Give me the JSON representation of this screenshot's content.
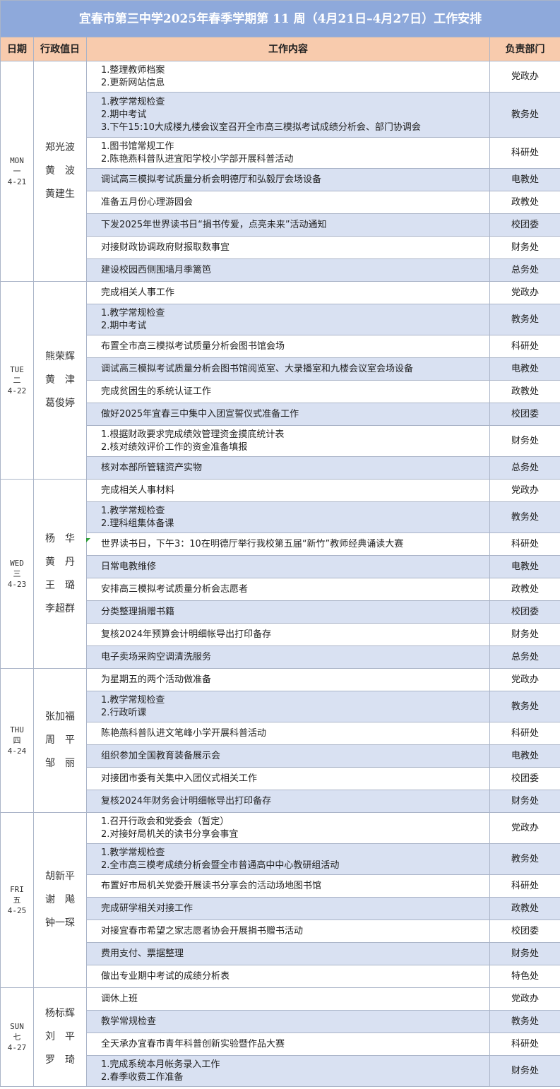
{
  "title": "宜春市第三中学2025年春季学期第 11 周（4月21日–4月27日）工作安排",
  "headers": {
    "date": "日期",
    "duty": "行政值日",
    "content": "工作内容",
    "dept": "负责部门"
  },
  "colors": {
    "title_bg": "#8ea9db",
    "header_bg": "#f8cbad",
    "alt_row": "#d9e1f2"
  },
  "days": [
    {
      "code": "MON",
      "cn": "一",
      "date": "4-21",
      "duty": [
        "郑光波",
        "黄　波",
        "黄建生"
      ],
      "items": [
        {
          "lines": [
            "1.整理教师档案",
            "2.更新网站信息"
          ],
          "dept": "党政办"
        },
        {
          "lines": [
            "1.教学常规检查",
            "2.期中考试",
            "3.下午15:10大成楼九楼会议室召开全市高三模拟考试成绩分析会、部门协调会"
          ],
          "dept": "教务处"
        },
        {
          "lines": [
            "1.图书馆常规工作",
            "2.陈艳燕科普队进宜阳学校小学部开展科普活动"
          ],
          "dept": "科研处"
        },
        {
          "lines": [
            "调试高三模拟考试质量分析会明德厅和弘毅厅会场设备"
          ],
          "dept": "电教处"
        },
        {
          "lines": [
            "准备五月份心理游园会"
          ],
          "dept": "政教处"
        },
        {
          "lines": [
            "下发2025年世界读书日“捐书传爱，点亮未来”活动通知"
          ],
          "dept": "校团委"
        },
        {
          "lines": [
            "对接财政协调政府财报取数事宜"
          ],
          "dept": "财务处"
        },
        {
          "lines": [
            "建设校园西侧围墙月季篱笆"
          ],
          "dept": "总务处"
        }
      ]
    },
    {
      "code": "TUE",
      "cn": "二",
      "date": "4-22",
      "duty": [
        "熊荣辉",
        "黄　津",
        "葛俊婷"
      ],
      "items": [
        {
          "lines": [
            "完成相关人事工作"
          ],
          "dept": "党政办"
        },
        {
          "lines": [
            "1.教学常规检查",
            "2.期中考试"
          ],
          "dept": "教务处"
        },
        {
          "lines": [
            "布置全市高三模拟考试质量分析会图书馆会场"
          ],
          "dept": "科研处"
        },
        {
          "lines": [
            "调试高三模拟考试质量分析会图书馆阅览室、大录播室和九楼会议室会场设备"
          ],
          "dept": "电教处"
        },
        {
          "lines": [
            "完成贫困生的系统认证工作"
          ],
          "dept": "政教处"
        },
        {
          "lines": [
            "做好2025年宜春三中集中入团宣誓仪式准备工作"
          ],
          "dept": "校团委"
        },
        {
          "lines": [
            "1.根据财政要求完成绩效管理资金摸底统计表",
            "2.核对绩效评价工作的资金准备填报"
          ],
          "dept": "财务处"
        },
        {
          "lines": [
            "核对本部所管辖资产实物"
          ],
          "dept": "总务处"
        }
      ]
    },
    {
      "code": "WED",
      "cn": "三",
      "date": "4-23",
      "duty": [
        "杨　华",
        "黄　丹",
        "王　璐",
        "李超群"
      ],
      "items": [
        {
          "lines": [
            "完成相关人事材料"
          ],
          "dept": "党政办"
        },
        {
          "lines": [
            "1.教学常规检查",
            "2.理科组集体备课"
          ],
          "dept": "教务处"
        },
        {
          "lines": [
            "世界读书日，下午3：10在明德厅举行我校第五届“新竹”教师经典诵读大赛"
          ],
          "dept": "科研处"
        },
        {
          "lines": [
            "日常电教维修"
          ],
          "dept": "电教处"
        },
        {
          "lines": [
            "安排高三模拟考试质量分析会志愿者"
          ],
          "dept": "政教处"
        },
        {
          "lines": [
            "分类整理捐赠书籍"
          ],
          "dept": "校团委"
        },
        {
          "lines": [
            "复核2024年预算会计明细帐导出打印备存"
          ],
          "dept": "财务处"
        },
        {
          "lines": [
            "电子卖场采购空调清洗服务"
          ],
          "dept": "总务处"
        }
      ]
    },
    {
      "code": "THU",
      "cn": "四",
      "date": "4-24",
      "duty": [
        "张加福",
        "周　平",
        "邹　丽"
      ],
      "items": [
        {
          "lines": [
            "为星期五的两个活动做准备"
          ],
          "dept": "党政办"
        },
        {
          "lines": [
            "1.教学常规检查",
            "2.行政听课"
          ],
          "dept": "教务处"
        },
        {
          "lines": [
            "陈艳燕科普队进文笔峰小学开展科普活动"
          ],
          "dept": "科研处"
        },
        {
          "lines": [
            "组织参加全国教育装备展示会"
          ],
          "dept": "电教处"
        },
        {
          "lines": [
            "对接团市委有关集中入团仪式相关工作"
          ],
          "dept": "校团委"
        },
        {
          "lines": [
            "复核2024年财务会计明细帐导出打印备存"
          ],
          "dept": "财务处"
        }
      ]
    },
    {
      "code": "FRI",
      "cn": "五",
      "date": "4-25",
      "duty": [
        "胡新平",
        "谢　飚",
        "钟一琛"
      ],
      "items": [
        {
          "lines": [
            "1.召开行政会和党委会（暂定）",
            "2.对接好局机关的读书分享会事宜"
          ],
          "dept": "党政办"
        },
        {
          "lines": [
            "1.教学常规检查",
            "2.全市高三模考成绩分析会暨全市普通高中中心教研组活动"
          ],
          "dept": "教务处"
        },
        {
          "lines": [
            "布置好市局机关党委开展读书分享会的活动场地图书馆"
          ],
          "dept": "科研处"
        },
        {
          "lines": [
            "完成研学相关对接工作"
          ],
          "dept": "政教处"
        },
        {
          "lines": [
            "对接宜春市希望之家志愿者协会开展捐书赠书活动"
          ],
          "dept": "校团委"
        },
        {
          "lines": [
            "费用支付、票据整理"
          ],
          "dept": "财务处"
        },
        {
          "lines": [
            "做出专业期中考试的成绩分析表"
          ],
          "dept": "特色处"
        }
      ]
    },
    {
      "code": "SUN",
      "cn": "七",
      "date": "4-27",
      "duty": [
        "杨标辉",
        "刘　平",
        "罗　琦"
      ],
      "items": [
        {
          "lines": [
            "调休上班"
          ],
          "dept": "党政办"
        },
        {
          "lines": [
            "教学常规检查"
          ],
          "dept": "教务处"
        },
        {
          "lines": [
            "全天承办宜春市青年科普创新实验暨作品大赛"
          ],
          "dept": "科研处"
        },
        {
          "lines": [
            "1.完成系统本月帐务录入工作",
            "2.春季收费工作准备"
          ],
          "dept": "财务处"
        }
      ]
    }
  ]
}
